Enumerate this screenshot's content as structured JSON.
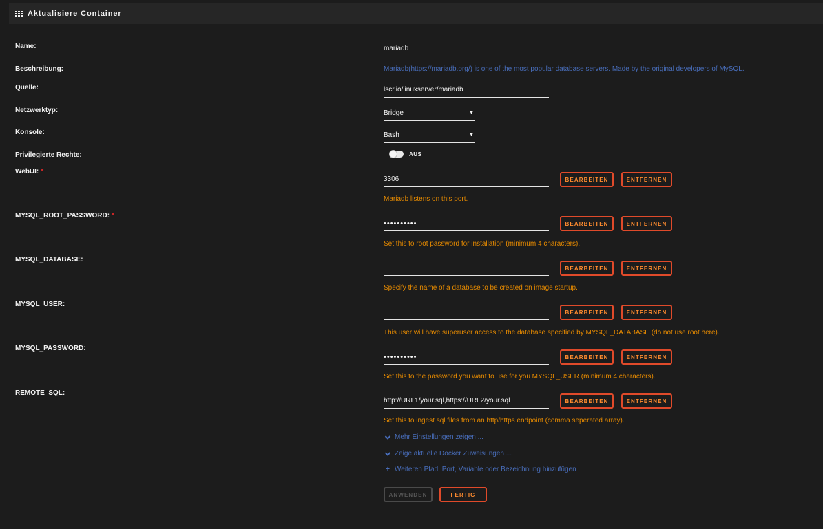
{
  "header": {
    "title": "Aktualisiere Container",
    "icon": "grid-icon"
  },
  "fields": {
    "name": {
      "label": "Name:",
      "value": "mariadb"
    },
    "description": {
      "label": "Beschreibung:",
      "value": "Mariadb(https://mariadb.org/) is one of the most popular database servers. Made by the original developers of MySQL."
    },
    "source": {
      "label": "Quelle:",
      "value": "lscr.io/linuxserver/mariadb"
    },
    "network": {
      "label": "Netzwerktyp:",
      "value": "Bridge"
    },
    "console": {
      "label": "Konsole:",
      "value": "Bash"
    },
    "privileged": {
      "label": "Privilegierte Rechte:",
      "state": "AUS"
    }
  },
  "configs": [
    {
      "label": "WebUI:",
      "required": "*",
      "value": "3306",
      "desc": "Mariadb listens on this port."
    },
    {
      "label": "MYSQL_ROOT_PASSWORD:",
      "required": "*",
      "value": "••••••••••",
      "desc": "Set this to root password for installation (minimum 4 characters)."
    },
    {
      "label": "MYSQL_DATABASE:",
      "required": "",
      "value": "",
      "desc": "Specify the name of a database to be created on image startup."
    },
    {
      "label": "MYSQL_USER:",
      "required": "",
      "value": "",
      "desc": "This user will have superuser access to the database specified by MYSQL_DATABASE (do not use root here)."
    },
    {
      "label": "MYSQL_PASSWORD:",
      "required": "",
      "value": "••••••••••",
      "desc": "Set this to the password you want to use for you MYSQL_USER (minimum 4 characters)."
    },
    {
      "label": "REMOTE_SQL:",
      "required": "",
      "value": "http://URL1/your.sql,https://URL2/your.sql",
      "desc": "Set this to ingest sql files from an http/https endpoint (comma seperated array)."
    }
  ],
  "buttons": {
    "edit": "BEARBEITEN",
    "remove": "ENTFERNEN",
    "apply": "ANWENDEN",
    "done": "FERTIG"
  },
  "links": {
    "more_settings": "Mehr Einstellungen zeigen ...",
    "docker_mappings": "Zeige aktuelle Docker Zuweisungen ...",
    "add_item": "Weiteren Pfad, Port, Variable oder Bezeichnung hinzufügen"
  },
  "colors": {
    "accent": "#ff8c2f",
    "border": "#e04a2a",
    "link": "#486dba",
    "desc": "#e68a00",
    "required": "#e22828"
  }
}
